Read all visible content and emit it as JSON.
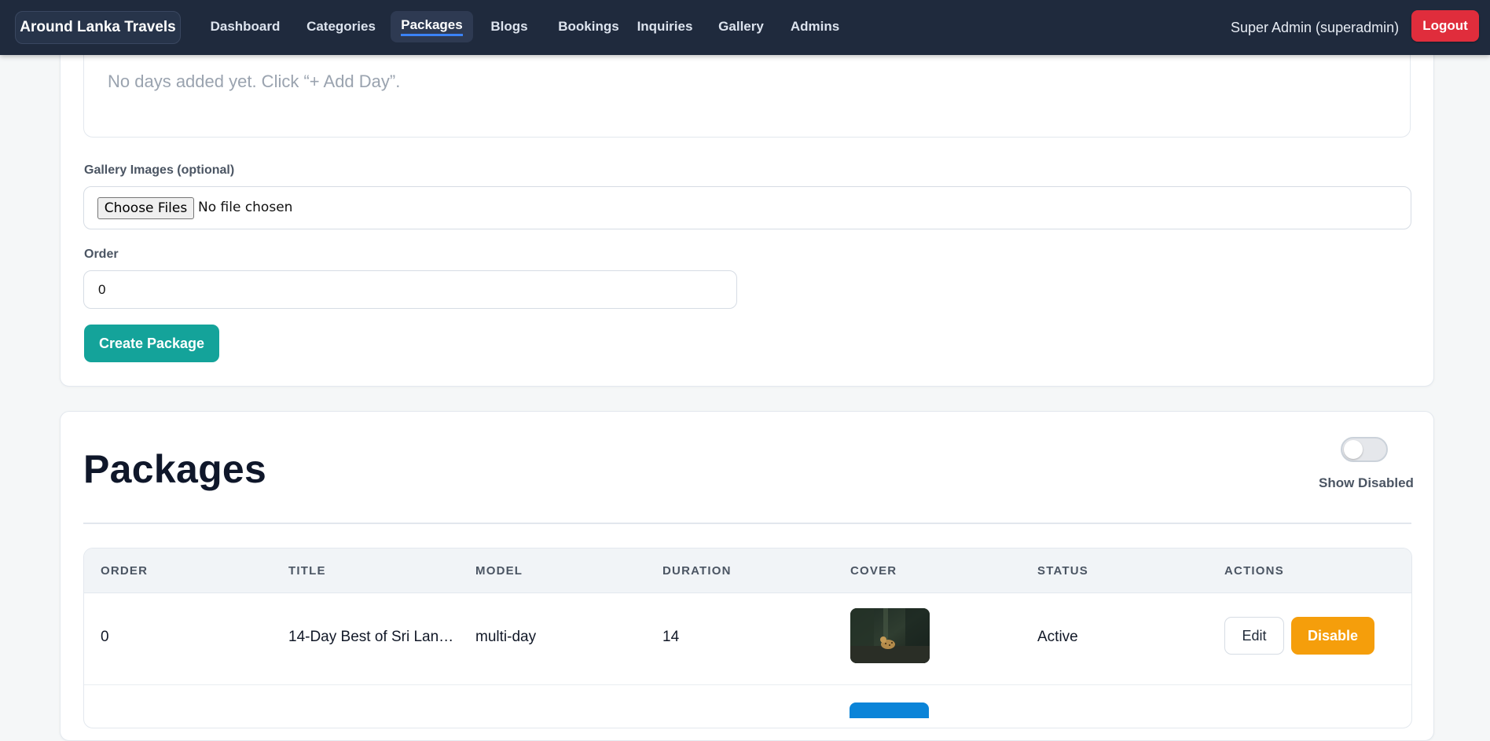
{
  "nav": {
    "brand": "Around Lanka Travels",
    "items": [
      {
        "label": "Dashboard"
      },
      {
        "label": "Categories"
      },
      {
        "label": "Packages",
        "active": true
      },
      {
        "label": "Blogs"
      },
      {
        "label": "Bookings"
      },
      {
        "label": "Inquiries"
      },
      {
        "label": "Gallery"
      },
      {
        "label": "Admins"
      }
    ],
    "user": "Super Admin (superadmin)",
    "logout_label": "Logout"
  },
  "form": {
    "days_empty_text": "No days added yet. Click “+ Add Day”.",
    "gallery_label": "Gallery Images (optional)",
    "choose_files_label": "Choose Files",
    "no_file_text": "No file chosen",
    "order_label": "Order",
    "order_value": "0",
    "submit_label": "Create Package"
  },
  "packages": {
    "title": "Packages",
    "show_disabled_label": "Show Disabled",
    "show_disabled_on": false,
    "columns": [
      "ORDER",
      "TITLE",
      "MODEL",
      "DURATION",
      "COVER",
      "STATUS",
      "ACTIONS"
    ],
    "rows": [
      {
        "order": "0",
        "title": "14-Day Best of Sri Lan…",
        "model": "multi-day",
        "duration": "14",
        "cover_icon": "leopard-photo",
        "status": "Active",
        "edit_label": "Edit",
        "disable_label": "Disable"
      }
    ]
  },
  "colors": {
    "nav_bg": "#1f2a3d",
    "logout": "#e02d3c",
    "primary": "#14a39a",
    "disable": "#f59e0b"
  }
}
